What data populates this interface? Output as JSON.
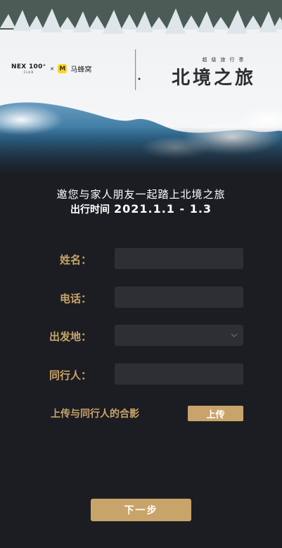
{
  "brand": {
    "nex_logo": "NEX 100⁺",
    "club": "CLUB",
    "separator": "×",
    "mfw_mark": "M",
    "mfw_name": "马蜂窝"
  },
  "hero": {
    "subtitle": "超级旅行季",
    "title": "北境之旅"
  },
  "invite": {
    "line1": "邀您与家人朋友一起踏上北境之旅",
    "time_label": "出行时间",
    "date": "2021.1.1 - 1.3"
  },
  "form": {
    "name": {
      "label": "姓名：",
      "value": ""
    },
    "phone": {
      "label": "电话：",
      "value": ""
    },
    "origin": {
      "label": "出发地：",
      "value": ""
    },
    "companion": {
      "label": "同行人：",
      "value": ""
    }
  },
  "upload": {
    "label": "上传与同行人的合影",
    "button": "上传"
  },
  "next_button": "下一步",
  "colors": {
    "accent": "#c8a46a",
    "background": "#1c1d22",
    "field": "#2e2f35"
  }
}
